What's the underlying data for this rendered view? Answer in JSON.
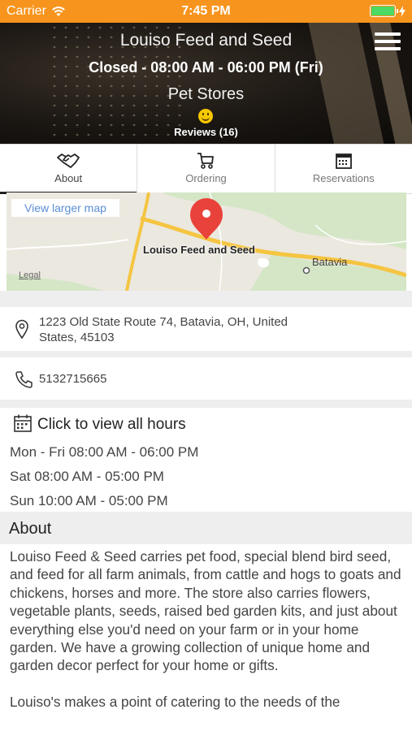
{
  "status_bar": {
    "carrier": "Carrier",
    "time": "7:45 PM",
    "battery_level": 1.0,
    "accent_color": "#f7941d"
  },
  "header": {
    "title": "Louiso Feed and Seed",
    "hours_status": "Closed - 08:00 AM - 06:00 PM (Fri)",
    "category": "Pet Stores",
    "reviews": "Reviews (16)",
    "rating_icon": "smiley-icon"
  },
  "tabs": [
    {
      "label": "About",
      "icon": "handshake-icon",
      "active": true
    },
    {
      "label": "Ordering",
      "icon": "cart-icon",
      "active": false
    },
    {
      "label": "Reservations",
      "icon": "calendar-icon",
      "active": false
    }
  ],
  "map": {
    "view_larger": "View larger map",
    "place_label": "Louiso Feed and Seed",
    "town_label": "Batavia",
    "legal": "Legal"
  },
  "contact": {
    "address": "1223 Old State Route 74, Batavia, OH, United States, 45103",
    "phone": "5132715665"
  },
  "hours": {
    "title": "Click to view all hours",
    "lines": [
      "Mon - Fri 08:00 AM - 06:00 PM",
      "Sat 08:00 AM - 05:00 PM",
      "Sun 10:00 AM - 05:00 PM"
    ]
  },
  "about": {
    "heading": "About",
    "paragraphs": [
      "Louiso Feed & Seed carries pet food, special blend bird seed, and feed for all farm animals, from cattle and hogs to goats and chickens, horses and more. The store also carries flowers, vegetable plants, seeds, raised bed garden kits, and just about everything else you'd need on your farm or in your home garden. We have a growing collection of unique home and garden decor perfect for your home or gifts.",
      "Louiso's makes a point of catering to the needs of the"
    ]
  }
}
